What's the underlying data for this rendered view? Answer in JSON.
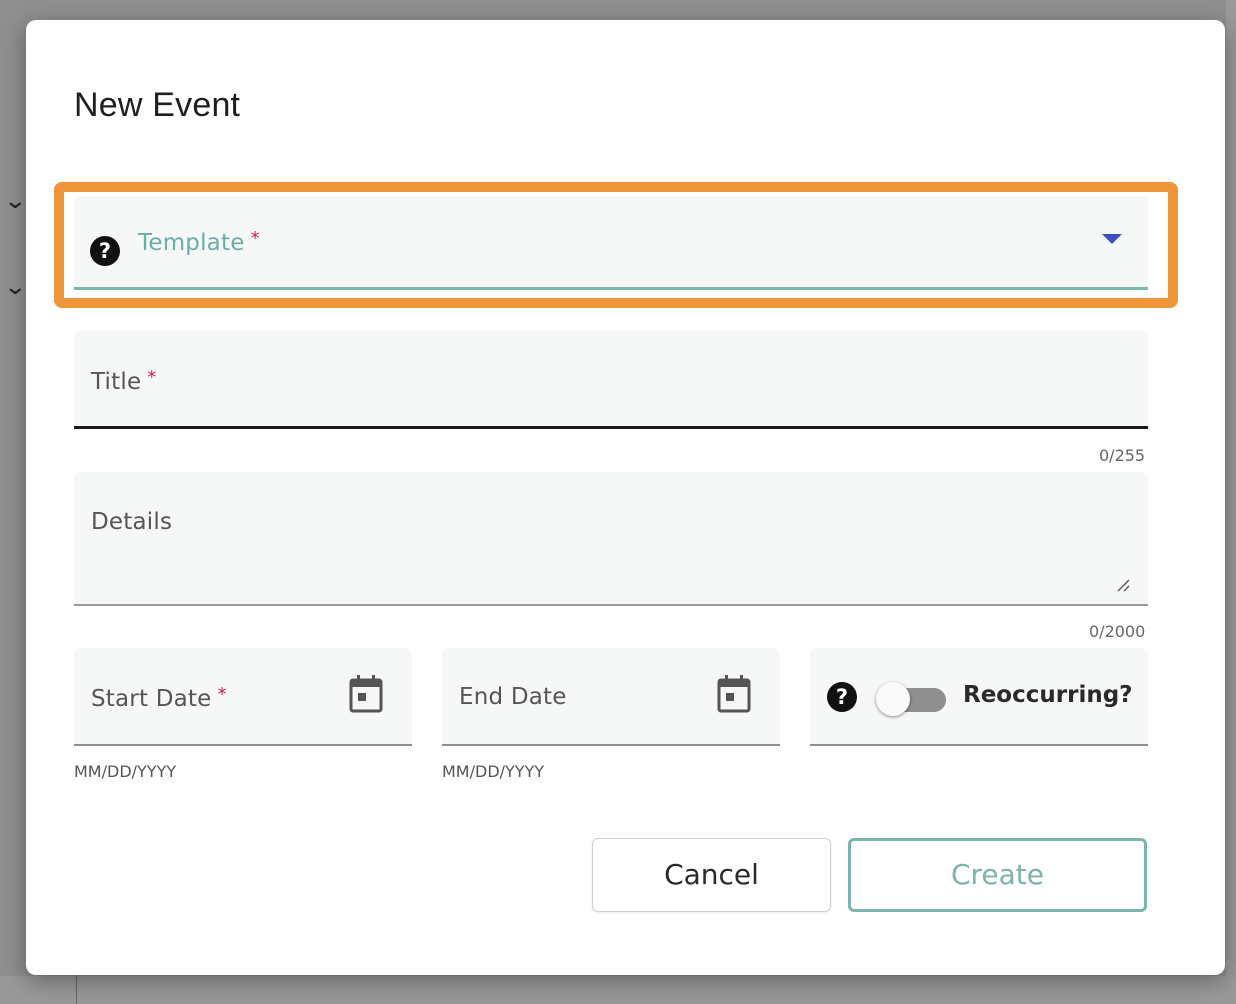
{
  "dialog": {
    "title": "New Event"
  },
  "fields": {
    "template": {
      "label": "Template",
      "required_mark": "*",
      "help_glyph": "?"
    },
    "title": {
      "label": "Title",
      "required_mark": "*",
      "counter": "0/255"
    },
    "details": {
      "label": "Details",
      "counter": "0/2000"
    },
    "start_date": {
      "label": "Start Date",
      "required_mark": "*",
      "hint": "MM/DD/YYYY"
    },
    "end_date": {
      "label": "End Date",
      "hint": "MM/DD/YYYY"
    },
    "reoccurring": {
      "label": "Reoccurring?",
      "help_glyph": "?",
      "enabled": false
    }
  },
  "buttons": {
    "cancel": "Cancel",
    "create": "Create"
  },
  "colors": {
    "highlight": "#f0963a",
    "accent_teal": "#7ab4ad",
    "required": "#d2185a",
    "dropdown_arrow": "#3f4fc1"
  },
  "icons": {
    "help": "help-circle-icon",
    "dropdown": "dropdown-arrow-icon",
    "calendar": "calendar-icon",
    "resize": "resize-grip-icon"
  }
}
